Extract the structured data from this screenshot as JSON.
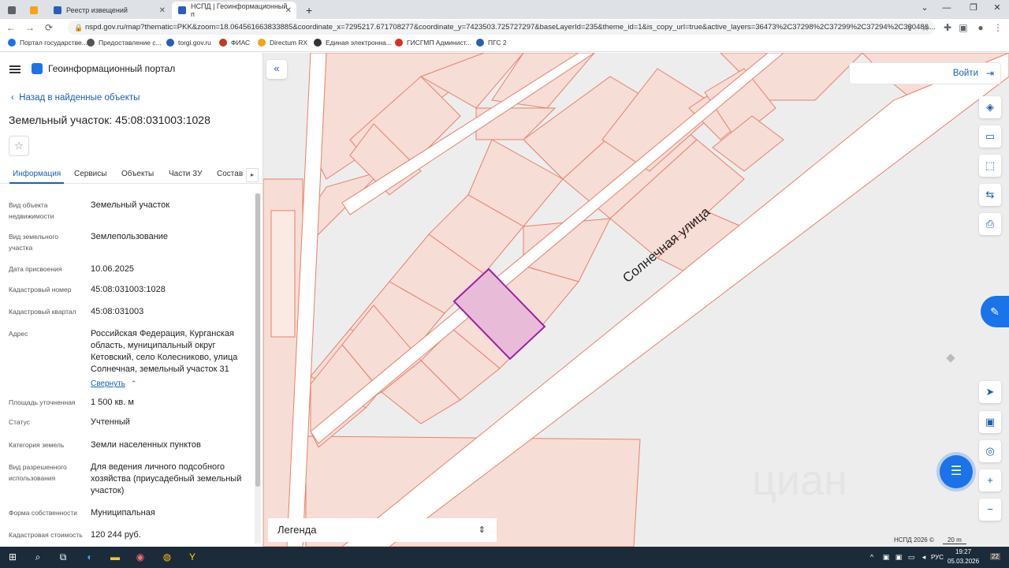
{
  "browser": {
    "tabs": [
      {
        "label": "",
        "color": "#5f6368"
      },
      {
        "label": "",
        "color": "#f4a31a"
      },
      {
        "label": "Реестр извещений",
        "color": "#2a5fb4"
      },
      {
        "label": "НСПД | Геоинформационный п",
        "color": "#2a5fb4"
      }
    ],
    "new_tab": "+",
    "url": "nspd.gov.ru/map?thematic=PKK&zoom=18.064561663833885&coordinate_x=7295217.671708277&coordinate_y=7423503.725727297&baseLayerId=235&theme_id=1&is_copy_url=true&active_layers=36473%2C37298%2C37299%2C37294%2C36048&...",
    "bookmarks": [
      {
        "label": "Портал государстве...",
        "color": "#1a73e8"
      },
      {
        "label": "Предоставление с...",
        "color": "#555"
      },
      {
        "label": "torgi.gov.ru",
        "color": "#2a5fb4"
      },
      {
        "label": "ФИАС",
        "color": "#c0392b"
      },
      {
        "label": "Directum RX",
        "color": "#f4a31a"
      },
      {
        "label": "Единая электронна...",
        "color": "#333"
      },
      {
        "label": "ГИСГМП Админист...",
        "color": "#d93025"
      },
      {
        "label": "ПГС 2",
        "color": "#2a5fb4"
      }
    ]
  },
  "panel": {
    "brand": "Геоинформационный портал",
    "back": "Назад в найденные объекты",
    "title": "Земельный участок: 45:08:031003:1028",
    "tabs": [
      "Информация",
      "Сервисы",
      "Объекты",
      "Части ЗУ",
      "Состав"
    ],
    "fields": [
      {
        "label": "Вид объекта недвижимости",
        "value": "Земельный участок"
      },
      {
        "label": "Вид земельного участка",
        "value": "Землепользование"
      },
      {
        "label": "Дата присвоения",
        "value": "10.06.2025"
      },
      {
        "label": "Кадастровый номер",
        "value": "45:08:031003:1028"
      },
      {
        "label": "Кадастровый квартал",
        "value": "45:08:031003"
      },
      {
        "label": "Адрес",
        "value": "Российская Федерация, Курганская область, муниципальный округ Кетовский, село Колесниково, улица Солнечная, земельный участок 31"
      },
      {
        "label": "Площадь уточненная",
        "value": "1 500 кв. м"
      },
      {
        "label": "Статус",
        "value": "Учтенный"
      },
      {
        "label": "Категория земель",
        "value": "Земли населенных пунктов"
      },
      {
        "label": "Вид разрешенного использования",
        "value": "Для ведения личного подсобного хозяйства (приусадебный земельный участок)"
      },
      {
        "label": "Форма собственности",
        "value": "Муниципальная"
      },
      {
        "label": "Кадастровая стоимость",
        "value": "120 244 руб."
      }
    ],
    "collapse_link": "Свернуть"
  },
  "map": {
    "login": "Войти",
    "street": "Солнечная  улица",
    "legend": "Легенда",
    "copyright": "НСПД 2026 ©",
    "scale": "20 m",
    "watermark": "циан",
    "parcel_fill": "#f6ddd6",
    "parcel_stroke": "#e8816b",
    "selected_fill": "#e8bcd8",
    "selected_stroke": "#a020a0"
  },
  "taskbar": {
    "lang": "РУС",
    "time": "19:27",
    "date": "05.03.2026",
    "badge": "22"
  }
}
